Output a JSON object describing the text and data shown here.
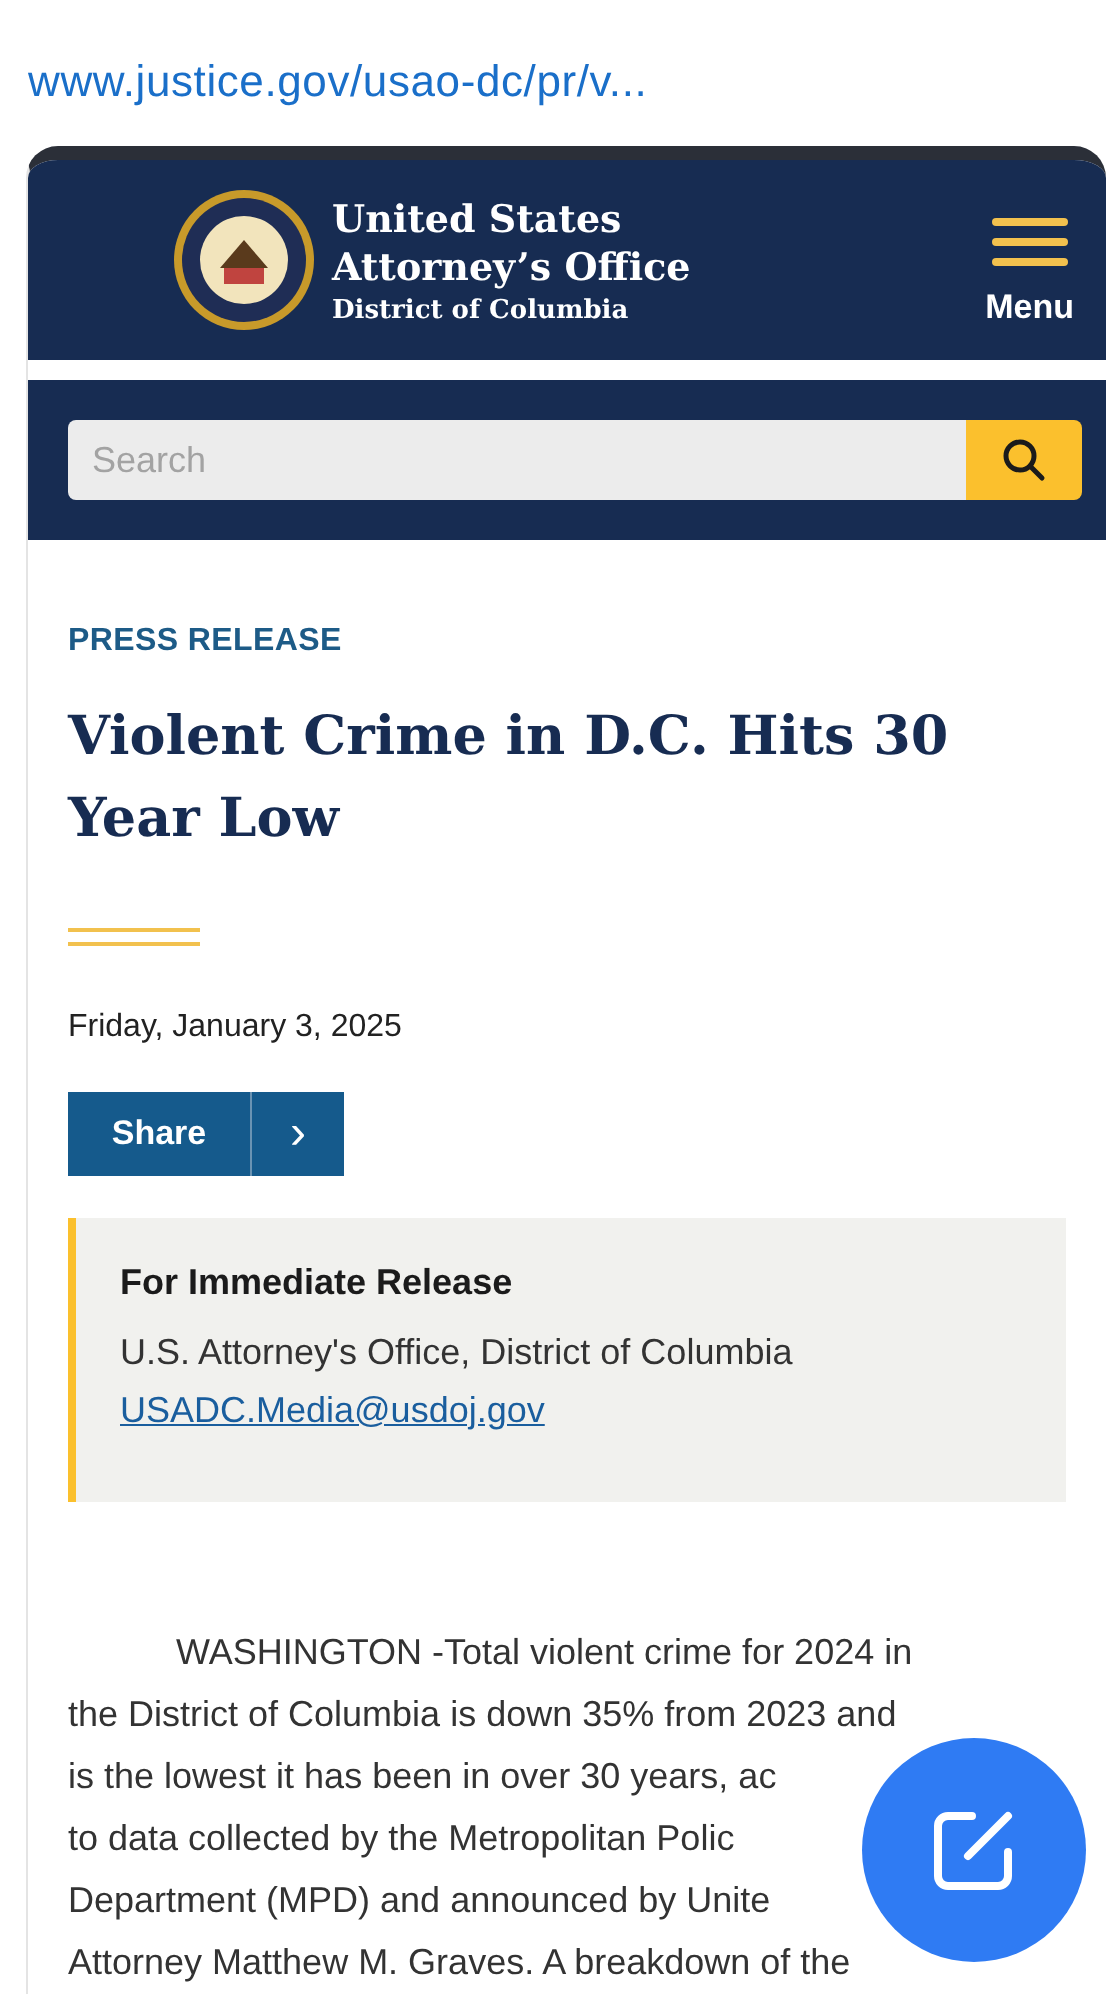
{
  "address_bar": {
    "url": "www.justice.gov/usao-dc/pr/v..."
  },
  "header": {
    "title": "United States",
    "subtitle": "Attorney’s Office",
    "district": "District of Columbia",
    "menu_label": "Menu"
  },
  "search": {
    "placeholder": "Search"
  },
  "article": {
    "category": "PRESS RELEASE",
    "title": "Violent Crime in D.C. Hits 30 Year Low",
    "date": "Friday, January 3, 2025",
    "share_label": "Share",
    "share_more": "›",
    "release_box": {
      "heading": "For Immediate Release",
      "office": "U.S. Attorney's Office, District of Columbia",
      "email": "USADC.Media@usdoj.gov"
    },
    "body_lines": [
      {
        "text": "WASHINGTON -Total violent crime for 2024 in",
        "indent": true
      },
      {
        "text": "the District of Columbia is down 35% from 2023 and",
        "indent": false
      },
      {
        "text": "is the lowest it has been in over 30 years, ac",
        "indent": false
      },
      {
        "text": "to data collected by the Metropolitan Polic",
        "indent": false
      },
      {
        "text": "Department (MPD) and announced by Unite",
        "indent": false
      },
      {
        "text": "Attorney Matthew M. Graves. A breakdown of the",
        "indent": false
      }
    ]
  }
}
